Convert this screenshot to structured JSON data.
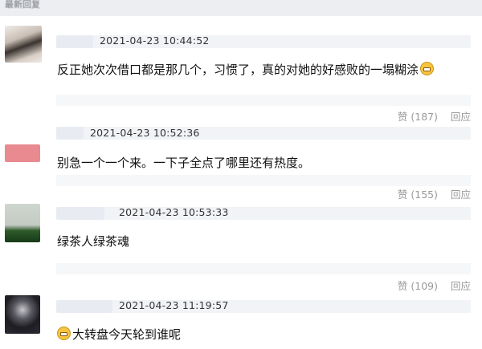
{
  "header": {
    "title": "最新回复"
  },
  "comments": [
    {
      "timestamp": "2021-04-23 10:44:52",
      "text": "反正她次次借口都是那几个，习惯了，真的对她的好感败的一塌糊涂",
      "emoji": "grinning-face-icon",
      "likes": "赞 (187)",
      "reply": "回应"
    },
    {
      "timestamp": "2021-04-23 10:52:36",
      "text": "别急一个一个来。一下子全点了哪里还有热度。",
      "likes": "赞 (155)",
      "reply": "回应"
    },
    {
      "timestamp": "2021-04-23 10:53:33",
      "text": "绿茶人绿茶魂",
      "likes": "赞 (109)",
      "reply": "回应"
    },
    {
      "timestamp": "2021-04-23 11:19:57",
      "text": "大转盘今天轮到谁呢",
      "emoji": "grinning-face-icon"
    }
  ],
  "colors": {
    "text": "#111111",
    "muted": "#9a9a9a",
    "meta_bg": "#f1f3f6",
    "accent_avatar2": "#e88a8f"
  }
}
